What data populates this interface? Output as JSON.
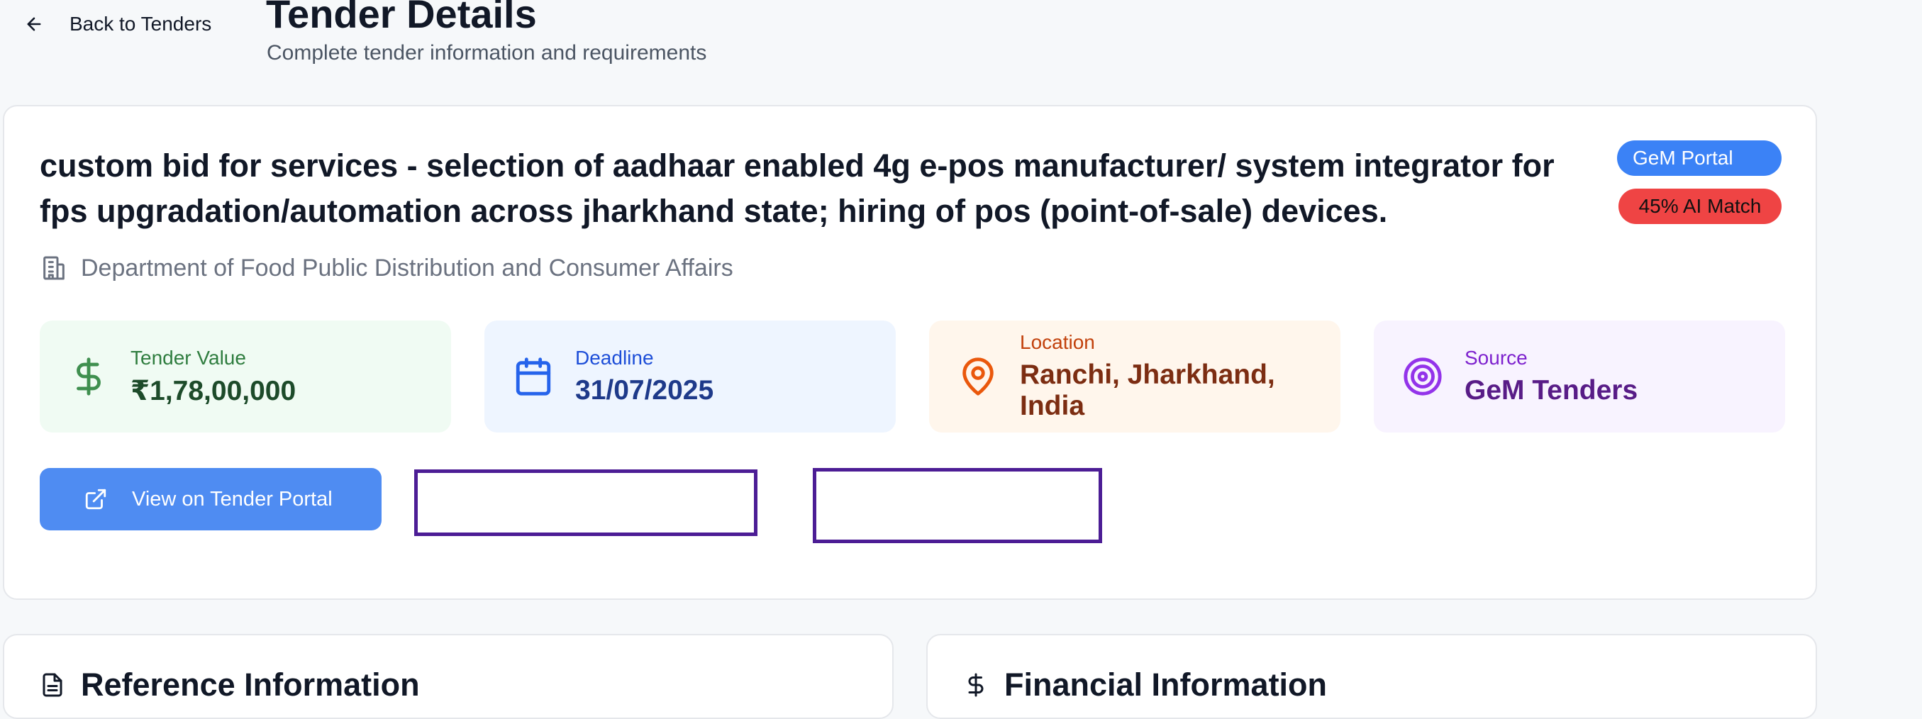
{
  "nav": {
    "back_label": "Back to Tenders"
  },
  "header": {
    "title": "Tender Details",
    "subtitle": "Complete tender information and requirements"
  },
  "tender": {
    "title": "custom bid for services - selection of aadhaar enabled 4g e-pos manufacturer/ system integrator for fps upgradation/automation across jharkhand state; hiring of pos (point-of-sale) devices.",
    "department": "Department of Food Public Distribution and Consumer Affairs",
    "badges": {
      "portal": "GeM Portal",
      "match": "45% AI Match"
    },
    "stats": {
      "value": {
        "label": "Tender Value",
        "value": "₹1,78,00,000",
        "icon": "dollar-icon"
      },
      "deadline": {
        "label": "Deadline",
        "value": "31/07/2025",
        "icon": "calendar-icon"
      },
      "location": {
        "label": "Location",
        "value": "Ranchi, Jharkhand, India",
        "icon": "map-pin-icon"
      },
      "source": {
        "label": "Source",
        "value": "GeM Tenders",
        "icon": "target-icon"
      }
    },
    "actions": {
      "portal_button": "View on Tender Portal"
    }
  },
  "sections": {
    "reference": {
      "title": "Reference Information",
      "icon": "document-icon"
    },
    "financial": {
      "title": "Financial Information",
      "icon": "dollar-icon"
    }
  },
  "colors": {
    "primary": "#4f8cf2",
    "badge_portal": "#3b82f6",
    "badge_match": "#ef4444",
    "outline": "#4c1d95"
  }
}
